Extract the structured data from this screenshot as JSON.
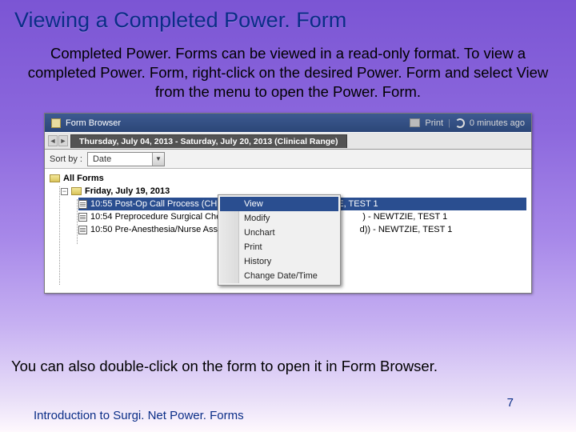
{
  "title": "Viewing a Completed Power. Form",
  "intro": "Completed Power. Forms can be viewed in a read-only format.  To view a completed Power. Form, right-click on the desired Power. Form and select View from the menu to open the Power. Form.",
  "bottom": "You can also double-click on the form to open it in Form Browser.",
  "footer": "Introduction to Surgi. Net Power. Forms",
  "page": "7",
  "app": {
    "window_title": "Form Browser",
    "print_label": "Print",
    "refresh_label": "0 minutes ago",
    "tab_label": "Thursday, July 04, 2013 - Saturday, July 20, 2013 (Clinical Range)",
    "sort_label": "Sort by :",
    "sort_value": "Date",
    "root": "All Forms",
    "date_group": "Friday, July 19, 2013",
    "rows": [
      "10:55 Post-Op Call Process (CHKD) (Auth (Verified)) - NEWTZIE, TEST 1",
      "10:54 Preprocedure Surgical Check",
      "10:50 Pre-Anesthesia/Nurse Asses"
    ],
    "row_tail_1": ") - NEWTZIE, TEST 1",
    "row_tail_2": "d)) - NEWTZIE, TEST 1",
    "menu": [
      "View",
      "Modify",
      "Unchart",
      "Print",
      "History",
      "Change Date/Time"
    ]
  }
}
